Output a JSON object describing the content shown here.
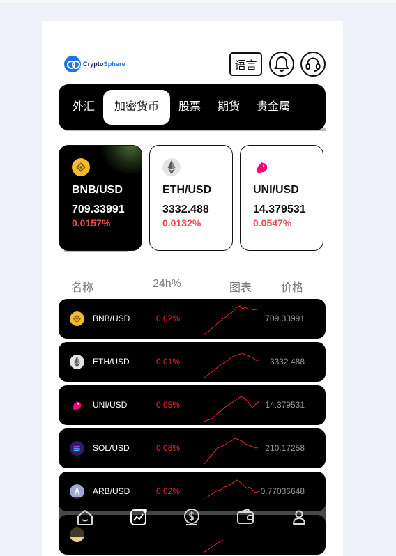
{
  "header": {
    "brand_prefix": "Crypto",
    "brand_suffix": "Sphere",
    "language_label": "语言"
  },
  "tabs": [
    {
      "label": "外汇",
      "active": false
    },
    {
      "label": "加密货币",
      "active": true
    },
    {
      "label": "股票",
      "active": false
    },
    {
      "label": "期货",
      "active": false
    },
    {
      "label": "贵金属",
      "active": false
    }
  ],
  "featured": [
    {
      "pair": "BNB/USD",
      "price": "709.33991",
      "change": "0.0157%",
      "icon": "bnb-coin-icon"
    },
    {
      "pair": "ETH/USD",
      "price": "3332.488",
      "change": "0.0132%",
      "icon": "eth-coin-icon"
    },
    {
      "pair": "UNI/USD",
      "price": "14.379531",
      "change": "0.0547%",
      "icon": "uni-coin-icon"
    }
  ],
  "list_header": {
    "name": "名称",
    "change": "24h%",
    "chart": "图表",
    "price": "价格"
  },
  "rows": [
    {
      "pair": "BNB/USD",
      "change": "0.02%",
      "price": "709.33991",
      "icon": "bnb-coin-icon"
    },
    {
      "pair": "ETH/USD",
      "change": "0.01%",
      "price": "3332.488",
      "icon": "eth-coin-icon"
    },
    {
      "pair": "UNI/USD",
      "change": "0.05%",
      "price": "14.379531",
      "icon": "uni-coin-icon"
    },
    {
      "pair": "SOL/USD",
      "change": "0.08%",
      "price": "210.17258",
      "icon": "sol-coin-icon"
    },
    {
      "pair": "ARB/USD",
      "change": "0.02%",
      "price": "0.77036648",
      "icon": "arb-coin-icon"
    }
  ],
  "nav": [
    {
      "icon": "home-icon"
    },
    {
      "icon": "market-chart-icon"
    },
    {
      "icon": "dollar-coin-icon"
    },
    {
      "icon": "wallet-icon"
    },
    {
      "icon": "user-icon"
    }
  ],
  "colors": {
    "accent_red": "#f0242b",
    "brand_blue": "#1f74e6",
    "bnb_gold": "#f3ba2f",
    "uni_pink": "#ff007a"
  }
}
